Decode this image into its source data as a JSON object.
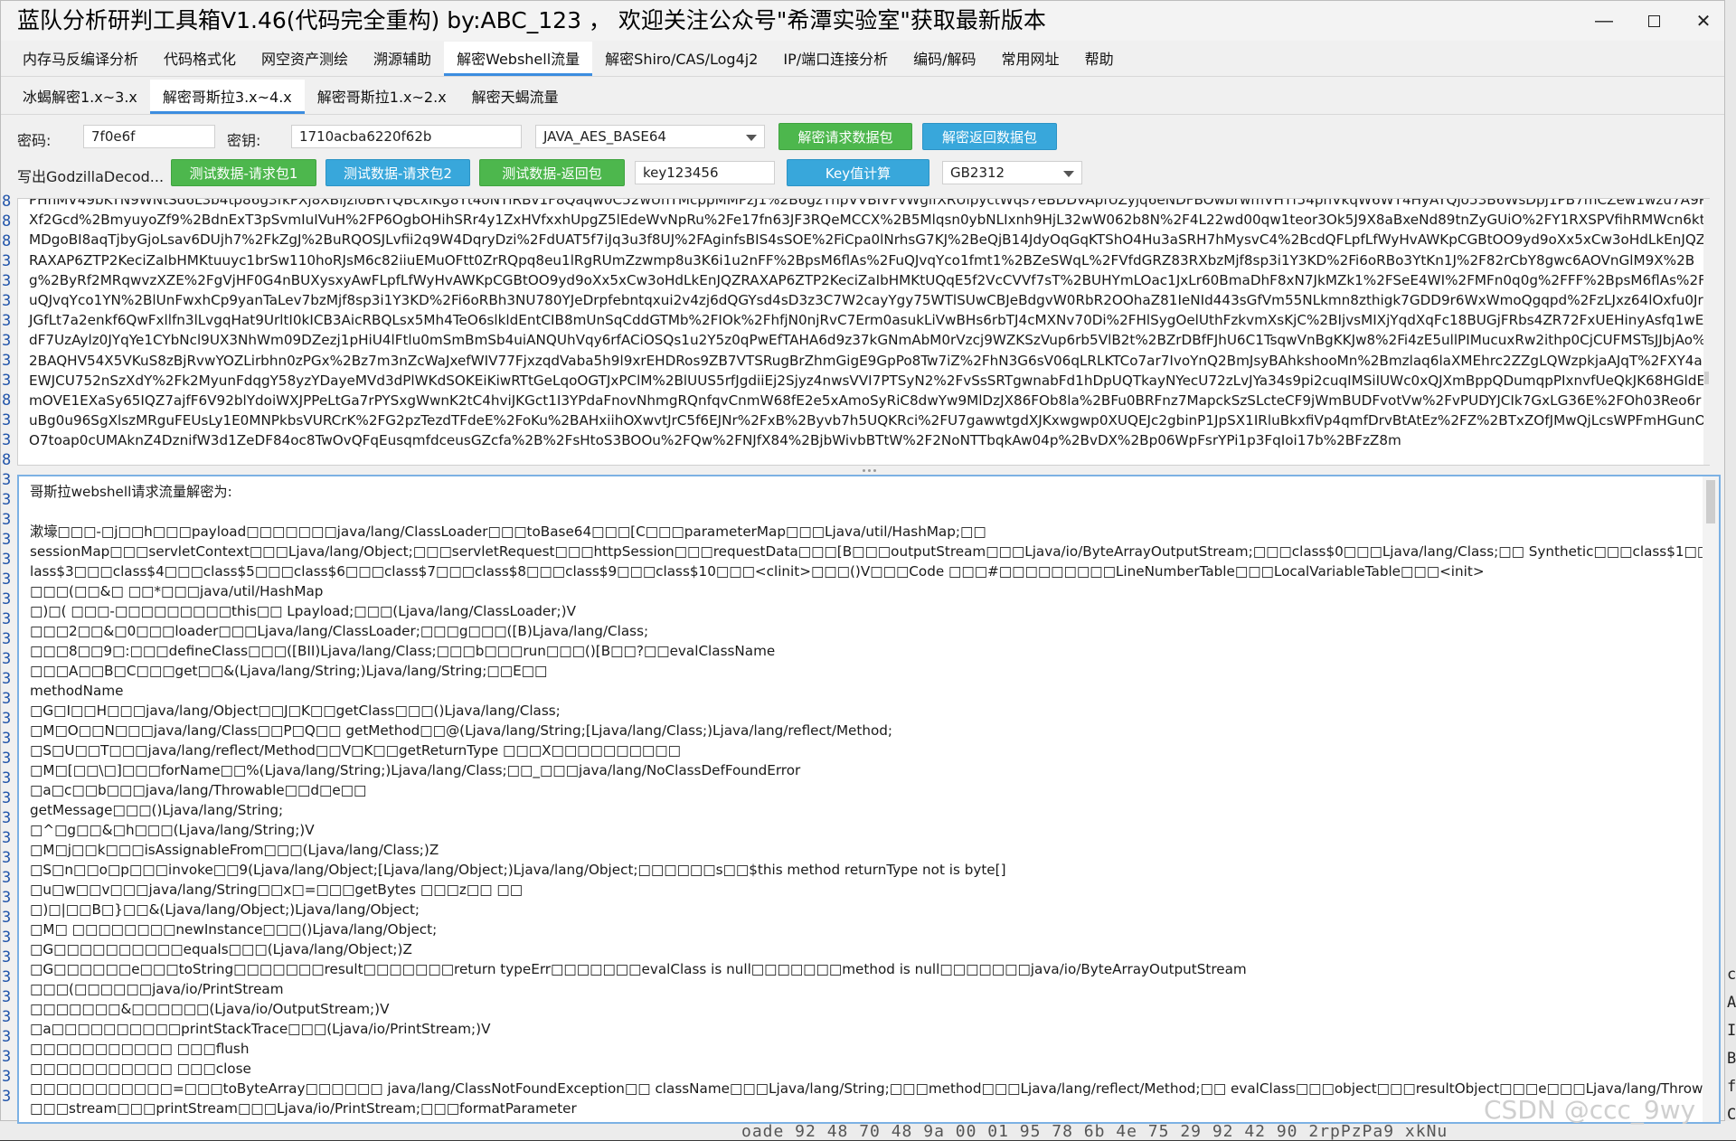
{
  "window": {
    "title": "蓝队分析研判工具箱V1.46(代码完全重构) by:ABC_123 ，  欢迎关注公众号\"希潭实验室\"获取最新版本"
  },
  "main_tabs": [
    {
      "label": "内存马反编译分析",
      "active": false
    },
    {
      "label": "代码格式化",
      "active": false
    },
    {
      "label": "网空资产测绘",
      "active": false
    },
    {
      "label": "溯源辅助",
      "active": false
    },
    {
      "label": "解密Webshell流量",
      "active": true
    },
    {
      "label": "解密Shiro/CAS/Log4j2",
      "active": false
    },
    {
      "label": "IP/端口连接分析",
      "active": false
    },
    {
      "label": "编码/解码",
      "active": false
    },
    {
      "label": "常用网址",
      "active": false
    },
    {
      "label": "帮助",
      "active": false
    }
  ],
  "sub_tabs": [
    {
      "label": "冰蝎解密1.x~3.x",
      "active": false
    },
    {
      "label": "解密哥斯拉3.x~4.x",
      "active": true
    },
    {
      "label": "解密哥斯拉1.x~2.x",
      "active": false
    },
    {
      "label": "解密天蝎流量",
      "active": false
    }
  ],
  "keys": {
    "password_label": "密码:",
    "password_value": "7f0e6f",
    "key_label": "密钥:",
    "key_value": "1710acba6220f62b",
    "mode_value": "JAVA_AES_BASE64",
    "decrypt_request_label": "解密请求数据包",
    "decrypt_response_label": "解密返回数据包"
  },
  "tests": {
    "label": "写出GodzillaDecod...",
    "test_req1_label": "测试数据-请求包1",
    "test_req2_label": "测试数据-请求包2",
    "test_resp_label": "测试数据-返回包",
    "key_input_value": "key123456",
    "key_calc_label": "Key值计算",
    "charset_value": "GB2312"
  },
  "payload": {
    "text": "PHhMV49bKTN9WNtSd6L3b4tp86g3fkPXj8XBljzloBRYQBcxlKg8Yt4oNYlRBv1F8Qaqw0C52wUhTMcppMMPzJ1%2B6gzTnpVVBIVFvWglfXRUipyctWqs7eBDDVApfUZyjq6eNDFBOwbrwmVHTf54pnVkqW6WT4HyAYQjo53B6WsDpj1PB7mCZew1wzu7A9PXf2Gcd%2BmyuyoZf9%2BdnExT3pSvmIuIVuH%2FP6OgbOHihSRr4y1ZxHVfxxhUpgZ5lEdeWvNpRu%2Fe17fn63JF3RQeMCCX%2B5Mlqsn0ybNLIxnh9HjL32wW062b8N%2F4L22wd00qw1teor3Ok5J9X8aBxeNd89tnZyGUiO%2FY1RXSPVfihRMWcn6ktMDgoBI8aqTjbyGjoLsav6DUjh7%2FkZgJ%2BuRQOSJLvfii2q9W4DqryDzi%2FdUAT5f7iJq3u3f8UJ%2FAginfsBIS4sSOE%2FiCpa0lNrhsG7KJ%2BeQjB14JdyOqGqKTShO4Hu3aSRH7hMysvC4%2BcdQFLpfLfWyHvAWKpCGBtOO9yd9oXx5xCw3oHdLkEnJQZRAXAP6ZTP2KeciZaIbHMKtuuyc1brSw110hoRJsM6c82iiuEMuOFtt0ZrRQpq8eu1lRgRUmZzwmp8u3K6i1u2nFF%2BpsM6flAs%2FuQJvqYco1fmt1%2BZeSWqL%2FVfdGRZ83RXbzMjf8sp3i1Y3KD%2Fi6oRBo3YtKn1J%2F82rCbY8gwc6AOVnGlM9X%2Bg%2ByRf2MRqwvzXZE%2FgVjHF0G4nBUXysxyAwFLpfLfWyHvAWKpCGBtOO9yd9oXx5xCw3oHdLkEnJQZRAXAP6ZTP2KeciZaIbHMKtUQqE5f2VcCVVf7sT%2BUHYmLOac1JxLr60BmaDhF8xN7JkMZk1%2FSeE4WI%2FMFn0q0g%2FFF%2BpsM6flAs%2FuQJvqYco1YN%2BlUnFwxhCp9yanTaLev7bzMjf8sp3i1Y3KD%2Fi6oRBh3NU780YJeDrpfebntqxui2v4zj6dQGYsd4sD3z3C7W2cayYgy75WTlSUwCBJeBdgvW0RbR2OOhaZ81IeNId443sGfVm55NLkmn8zthigk7GDD9r6WxWmoQgqpd%2FzLJxz64lOxfu0JrJGfLt7a2enkf6QwFxllfn3lLvgqHat9UrltI0kICB3AicRBQLsx5Mh4TeO6slkldEntCIB8mUnSqCddGTMb%2FIOk%2FhfjN0njRvC7Erm0asukLiVwBHs6rbTJ4cMXNv70Di%2FHlSygOelUthFzkvmXsKjC%2BIjvsMIXjYqdXqFc18BUGjFRbs4ZR72FxUEHinyAsfq1wEdF7UzAylz0JYqYe1CYbNcl9UX3NhWm09DZezj1pHiU4lFtlu0mSmBmSb4uiANQUhVqy6rfACiOSQs1u2Y5z0qPwEfTAHA6d9z37kGNmAbM0rVzcj9WZKSzVup6rb5VlB2t%2BZrDBfFJhU6C1TsqwVnBgKKJw8%2Fi4zE5ullPIMucuxRw2ithp0CjCUFMSTsJJbjAo%2BAQHV54X5VKuS8zBjRvwYOZLirbhn0zPGx%2Bz7m3nZcWaJxefWIV77FjxzqdVaba5h9l9xrEHDRos9ZB7VTSRugBrZhmGigE9GpPo8Tw7iZ%2FhN3G6sV06qLRLKTCo7ar7IvoYnQ2BmJsyBAhkshooMn%2Bmzlaq6laXMEhrc2ZZgLQWzpkjaAJqT%2FXY4aEWJCU752nSzXdY%2Fk2MyunFdqgY58yzYDayeMVd3dPlWKdSOKEiKiwRTtGeLqoOGTJxPClM%2BlUUS5rfJgdiiEj2Sjyz4nwsVVI7PTSyN2%2FvSsSRTgwnabFd1hDpUQTkayNYecU72zLvJYa34s9pi2cuqIMSiIUWc0xQJXmBppQDumqpPIxnvfUeQkJK68HGldEmOVE1EXaSy65IQZ7ajfF6V92blYdoiWXJPPeLtGa7rPYSxgWwnK2tC4hviJKGct1I3YPdaFnovNhmgRQnfqvCnmW68fE2e5xAmoSyRiC8dwYw9MlDzJX86FOb8la%2BFu0BRFnz7MapckSzSLcteCF9jWmBUDFvotVw%2FvPUDYJCIk7GxLG36E%2FOh03Reo6ruBg0u96SgXlszMRguFEUsLy1E0MNPkbsVURCrK%2FG2pzTezdTFdeE%2FoKu%2BAHxiihOXwvtJrC5f6EJNr%2FxB%2Byvb7h5UQKRci%2FU7gawwtgdXJKxwgwp0XUQEJc2gbinP1JpSX1IRluBkxfiVp4qmfDrvBtAtEz%2FZ%2BTxZOfJMwQjLcsWPFmHGunOO7toap0cUMAknZ4DznifW3d1ZeDF84oc8TwOvQFqEusqmfdceusGZcfa%2B%2FsHtoS3BOOu%2FQw%2FNJfX84%2BjbWivbBTtW%2F2NoNTTbqkAw04p%2BvDX%2Bp06WpFsrYPi1p3FqIoi17b%2BFzZ8m"
  },
  "output": {
    "lines": [
      "哥斯拉webshell请求流量解密为:",
      "",
      "漱壕□□□-□j□□h□□□payload□□□□□□□java/lang/ClassLoader□□□toBase64□□□[C□□□parameterMap□□□Ljava/util/HashMap;□□",
      "sessionMap□□□servletContext□□□Ljava/lang/Object;□□□servletRequest□□□httpSession□□□requestData□□□[B□□□outputStream□□□Ljava/io/ByteArrayOutputStream;□□□class$0□□□Ljava/lang/Class;□□      Synthetic□□□class$1□□□class$2□□□c",
      "lass$3□□□class$4□□□class$5□□□class$6□□□class$7□□□class$8□□□class$9□□□class$10□□□<clinit>□□□()V□□□Code                □□□#□□□□□□□□□LineNumberTable□□□LocalVariableTable□□□<init>",
      "□□□(□□&□ □□*□□□java/util/HashMap",
      "□)□(            □□□-□□□□□□□□□this□□              Lpayload;□□□(Ljava/lang/ClassLoader;)V",
      "□□□2□□&□0□□□loader□□□Ljava/lang/ClassLoader;□□□g□□□([B)Ljava/lang/Class;",
      "□□□8□□9□:□□□defineClass□□□([BII)Ljava/lang/Class;□□□b□□□run□□□()[B□□?□□evalClassName",
      "□□□A□□B□C□□□get□□&(Ljava/lang/String;)Ljava/lang/String;□□E□□",
      "methodName",
      "□G□I□□H□□□java/lang/Object□□J□K□□getClass□□□()Ljava/lang/Class;",
      "□M□O□□N□□□java/lang/Class□□P□Q□□          getMethod□□@(Ljava/lang/String;[Ljava/lang/Class;)Ljava/lang/reflect/Method;",
      "□S□U□□T□□□java/lang/reflect/Method□□V□K□□getReturnType                □□□X□□□□□□□□□□",
      "□M□[□□\\□]□□□forName□□%(Ljava/lang/String;)Ljava/lang/Class;□□_□□□java/lang/NoClassDefFoundError",
      "□a□c□□b□□□java/lang/Throwable□□d□e□□",
      "getMessage□□□()Ljava/lang/String;",
      "□^□g□□&□h□□□(Ljava/lang/String;)V",
      "□M□j□□k□□□isAssignableFrom□□□(Ljava/lang/Class;)Z",
      "□S□n□□o□p□□□invoke□□9(Ljava/lang/Object;[Ljava/lang/Object;)Ljava/lang/Object;□□□□□□s□□$this method returnType not is byte[]",
      "□u□w□□v□□□java/lang/String□□x□=□□□getBytes                   □□□z□□          □□",
      "□)□|□□B□}□□&(Ljava/lang/Object;)Ljava/lang/Object;",
      "□M□ □□□□□□□□newInstance□□□()Ljava/lang/Object;",
      "□G□□□□□□□□□□equals□□□(Ljava/lang/Object;)Z",
      "□G□□□□□□e□□□toString□□□□□□□result□□□□□□□return typeErr□□□□□□□evalClass is null□□□□□□□method is null□□□□□□□java/io/ByteArrayOutputStream",
      "□□□(□□□□□□java/io/PrintStream",
      "□□□□□□□&□□□□□□(Ljava/io/OutputStream;)V",
      "□a□□□□□□□□□□printStackTrace□□□(Ljava/io/PrintStream;)V",
      "□□□□□□□□□□□ □□□flush",
      "□□□□□□□□□□□ □□□close",
      "□□□□□□□□□□□=□□□toByteArray□□□□□□ java/lang/ClassNotFoundException□□      className□□□Ljava/lang/String;□□□method□□□Ljava/lang/reflect/Method;□□                    evalClass□□□object□□□resultObject□□□e□□□Ljava/lang/Throwable;",
      "□□□stream□□□printStream□□□Ljava/io/PrintStream;□□□formatParameter",
      "□□□□□□□□□□□ □□□□□□□□"
    ]
  },
  "background": {
    "left_gutter": [
      "8",
      "8",
      "8",
      "3",
      "3",
      "3",
      "3",
      "3",
      "3",
      "3",
      "8",
      "3",
      "3",
      "8",
      "3",
      "3",
      "3",
      "3",
      "3",
      "3",
      "3",
      "3",
      "3",
      "3",
      "3",
      "3",
      "3",
      "3",
      "3",
      "3",
      "3",
      "3",
      "3",
      "3",
      "3",
      "3",
      "3",
      "3",
      "3",
      "3",
      "3",
      "3",
      "3",
      "3",
      "3",
      "3"
    ],
    "right_gutter": [
      "c",
      "A",
      "I",
      "B",
      "f",
      "C"
    ],
    "bottom_strip": "oade    92 48 70 48 9a 00 01 95    78 6b 4e 75 29 92 42 90     2rpPzPa9 xkNu"
  },
  "watermark": "CSDN @ccc_9wy"
}
